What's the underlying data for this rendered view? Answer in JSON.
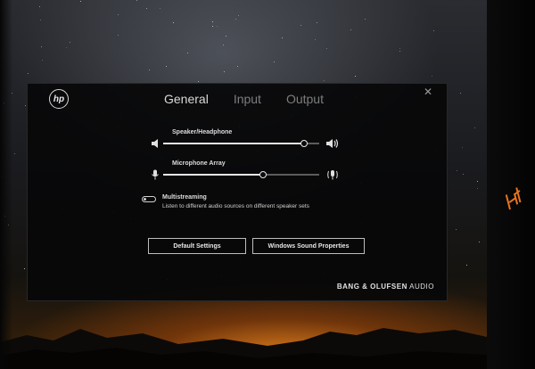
{
  "panel": {
    "logo_text": "hp",
    "close_glyph": "✕"
  },
  "tabs": [
    {
      "label": "General",
      "active": true
    },
    {
      "label": "Input",
      "active": false
    },
    {
      "label": "Output",
      "active": false
    }
  ],
  "speaker": {
    "label": "Speaker/Headphone",
    "level": 0.9,
    "icon_left": "speaker-low-icon",
    "icon_right": "speaker-high-icon"
  },
  "microphone": {
    "label": "Microphone Array",
    "level": 0.64,
    "icon_left": "microphone-icon",
    "icon_right": "microphone-waves-icon"
  },
  "multistreaming": {
    "title": "Multistreaming",
    "description": "Listen to different audio sources on different speaker sets",
    "enabled": false
  },
  "buttons": {
    "default_settings": "Default Settings",
    "windows_sound": "Windows Sound Properties"
  },
  "brand": {
    "name": "BANG & OLUFSEN",
    "suffix": "AUDIO"
  },
  "colors": {
    "panel_bg": "#080809",
    "active_tab": "#d9d9d9",
    "inactive_tab": "#7d7d7d",
    "accent_sunset": "#e6821e"
  }
}
